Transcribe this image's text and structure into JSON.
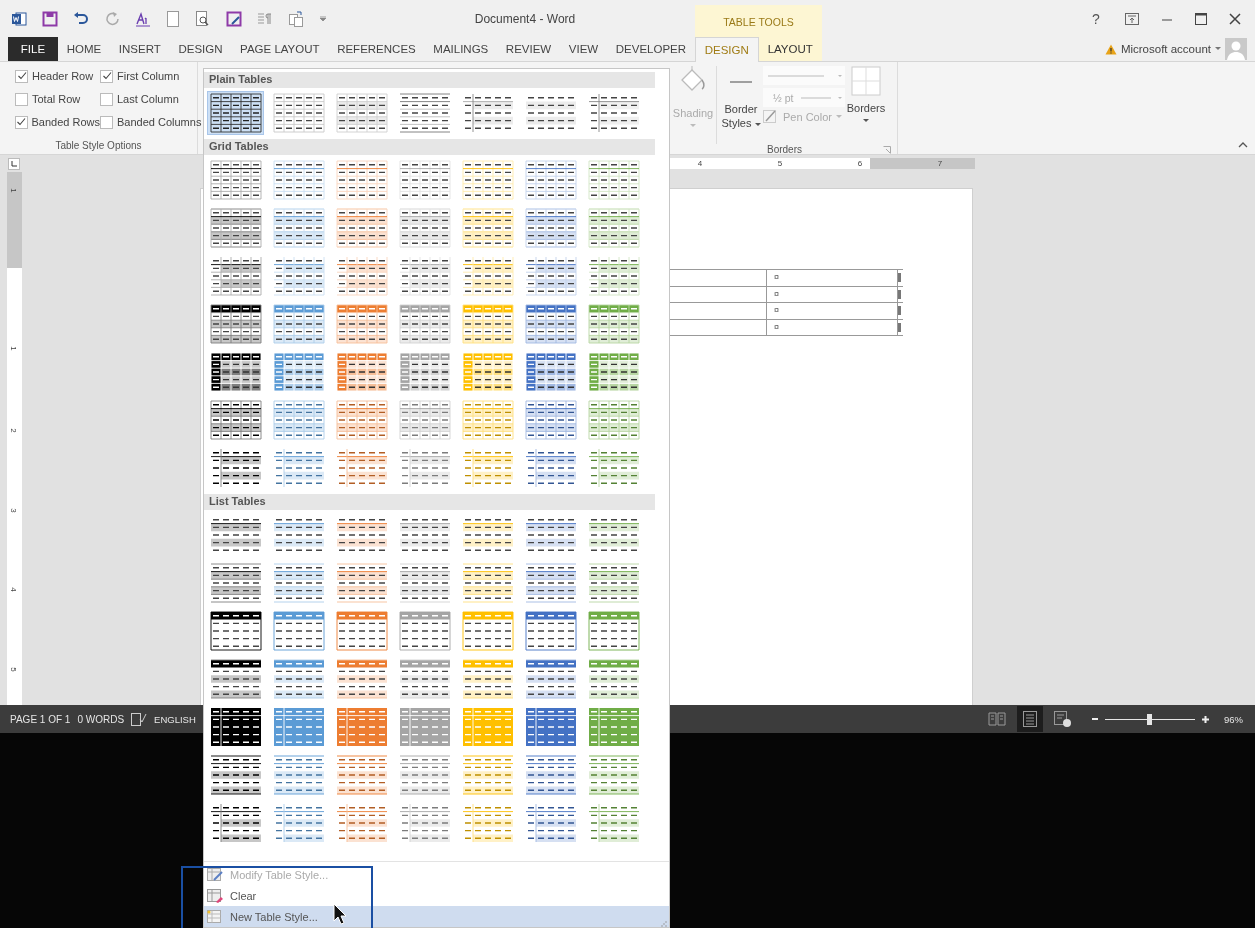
{
  "window": {
    "title": "Document4 - Word",
    "contextual_group": "TABLE TOOLS",
    "help_label": "?"
  },
  "ribbon_tabs": [
    {
      "label": "FILE",
      "kind": "file",
      "selected": false
    },
    {
      "label": "HOME",
      "kind": "normal",
      "selected": false
    },
    {
      "label": "INSERT",
      "kind": "normal",
      "selected": false
    },
    {
      "label": "DESIGN",
      "kind": "normal",
      "selected": false
    },
    {
      "label": "PAGE LAYOUT",
      "kind": "normal",
      "selected": false
    },
    {
      "label": "REFERENCES",
      "kind": "normal",
      "selected": false
    },
    {
      "label": "MAILINGS",
      "kind": "normal",
      "selected": false
    },
    {
      "label": "REVIEW",
      "kind": "normal",
      "selected": false
    },
    {
      "label": "VIEW",
      "kind": "normal",
      "selected": false
    },
    {
      "label": "DEVELOPER",
      "kind": "normal",
      "selected": false
    },
    {
      "label": "DESIGN",
      "kind": "contextual",
      "selected": true
    },
    {
      "label": "LAYOUT",
      "kind": "contextual",
      "selected": false
    }
  ],
  "account": {
    "label": "Microsoft account",
    "warning": true
  },
  "table_style_options": {
    "label": "Table Style Options",
    "options": [
      {
        "label": "Header Row",
        "checked": true
      },
      {
        "label": "First Column",
        "checked": true
      },
      {
        "label": "Total Row",
        "checked": false
      },
      {
        "label": "Last Column",
        "checked": false
      },
      {
        "label": "Banded Rows",
        "checked": true
      },
      {
        "label": "Banded Columns",
        "checked": false
      }
    ]
  },
  "borders_group": {
    "label": "Borders",
    "shading": {
      "label": "Shading",
      "disabled": true
    },
    "border_styles": {
      "label": "Border Styles"
    },
    "pen_weight": {
      "value": "½ pt"
    },
    "pen_color": {
      "label": "Pen Color",
      "disabled": true
    },
    "borders": {
      "label": "Borders"
    }
  },
  "ruler": {
    "horizontal_numbers": [
      "4",
      "5",
      "6",
      "7"
    ],
    "vertical_numbers": [
      "1",
      "1",
      "2",
      "3",
      "4",
      "5"
    ]
  },
  "document": {
    "table_rows": [
      {
        "column_2": "¤"
      },
      {
        "column_2": "¤"
      },
      {
        "column_2": "¤"
      },
      {
        "column_2": "¤"
      }
    ]
  },
  "status_bar": {
    "page": "PAGE 1 OF 1",
    "words": "0 WORDS",
    "language": "ENGLISH",
    "views": [
      {
        "kind": "read",
        "selected": false
      },
      {
        "kind": "print",
        "selected": true
      },
      {
        "kind": "web",
        "selected": false
      }
    ],
    "zoom": {
      "level": 0.5,
      "value": "96%"
    }
  },
  "gallery": {
    "sections": [
      {
        "title": "Plain Tables",
        "rows": [
          {
            "items": [
              {
                "kind": "table-grid",
                "selected": true
              },
              {
                "kind": "grid-table-light",
                "selected": false
              },
              {
                "kind": "plain-table-1",
                "selected": false
              },
              {
                "kind": "plain-table-2",
                "selected": false
              },
              {
                "kind": "plain-table-3",
                "selected": false
              },
              {
                "kind": "plain-table-4",
                "selected": false
              },
              {
                "kind": "plain-table-5",
                "selected": false
              }
            ]
          }
        ]
      },
      {
        "title": "Grid Tables",
        "rows": [
          {
            "kind": "grid-1",
            "items": [
              {
                "kind": "dark",
                "selected": false
              },
              {
                "kind": "accent-1",
                "selected": false
              },
              {
                "kind": "accent-2",
                "selected": false
              },
              {
                "kind": "accent-3",
                "selected": false
              },
              {
                "kind": "accent-4",
                "selected": false
              },
              {
                "kind": "accent-5",
                "selected": false
              },
              {
                "kind": "accent-6",
                "selected": false
              }
            ]
          },
          {
            "kind": "grid-2",
            "items": [
              {
                "kind": "dark",
                "selected": false
              },
              {
                "kind": "accent-1",
                "selected": false
              },
              {
                "kind": "accent-2",
                "selected": false
              },
              {
                "kind": "accent-3",
                "selected": false
              },
              {
                "kind": "accent-4",
                "selected": false
              },
              {
                "kind": "accent-5",
                "selected": false
              },
              {
                "kind": "accent-6",
                "selected": false
              }
            ]
          },
          {
            "kind": "grid-3",
            "items": [
              {
                "kind": "dark",
                "selected": false
              },
              {
                "kind": "accent-1",
                "selected": false
              },
              {
                "kind": "accent-2",
                "selected": false
              },
              {
                "kind": "accent-3",
                "selected": false
              },
              {
                "kind": "accent-4",
                "selected": false
              },
              {
                "kind": "accent-5",
                "selected": false
              },
              {
                "kind": "accent-6",
                "selected": false
              }
            ]
          },
          {
            "kind": "grid-4",
            "items": [
              {
                "kind": "dark",
                "selected": false
              },
              {
                "kind": "accent-1",
                "selected": false
              },
              {
                "kind": "accent-2",
                "selected": false
              },
              {
                "kind": "accent-3",
                "selected": false
              },
              {
                "kind": "accent-4",
                "selected": false
              },
              {
                "kind": "accent-5",
                "selected": false
              },
              {
                "kind": "accent-6",
                "selected": false
              }
            ]
          },
          {
            "kind": "grid-5",
            "items": [
              {
                "kind": "dark",
                "selected": false
              },
              {
                "kind": "accent-1",
                "selected": false
              },
              {
                "kind": "accent-2",
                "selected": false
              },
              {
                "kind": "accent-3",
                "selected": false
              },
              {
                "kind": "accent-4",
                "selected": false
              },
              {
                "kind": "accent-5",
                "selected": false
              },
              {
                "kind": "accent-6",
                "selected": false
              }
            ]
          },
          {
            "kind": "grid-6",
            "items": [
              {
                "kind": "dark",
                "selected": false
              },
              {
                "kind": "accent-1",
                "selected": false
              },
              {
                "kind": "accent-2",
                "selected": false
              },
              {
                "kind": "accent-3",
                "selected": false
              },
              {
                "kind": "accent-4",
                "selected": false
              },
              {
                "kind": "accent-5",
                "selected": false
              },
              {
                "kind": "accent-6",
                "selected": false
              }
            ]
          },
          {
            "kind": "grid-7",
            "items": [
              {
                "kind": "dark",
                "selected": false
              },
              {
                "kind": "accent-1",
                "selected": false
              },
              {
                "kind": "accent-2",
                "selected": false
              },
              {
                "kind": "accent-3",
                "selected": false
              },
              {
                "kind": "accent-4",
                "selected": false
              },
              {
                "kind": "accent-5",
                "selected": false
              },
              {
                "kind": "accent-6",
                "selected": false
              }
            ]
          }
        ]
      },
      {
        "title": "List Tables",
        "rows": [
          {
            "kind": "list-1",
            "items": [
              {
                "kind": "dark",
                "selected": false
              },
              {
                "kind": "accent-1",
                "selected": false
              },
              {
                "kind": "accent-2",
                "selected": false
              },
              {
                "kind": "accent-3",
                "selected": false
              },
              {
                "kind": "accent-4",
                "selected": false
              },
              {
                "kind": "accent-5",
                "selected": false
              },
              {
                "kind": "accent-6",
                "selected": false
              }
            ]
          },
          {
            "kind": "list-2",
            "items": [
              {
                "kind": "dark",
                "selected": false
              },
              {
                "kind": "accent-1",
                "selected": false
              },
              {
                "kind": "accent-2",
                "selected": false
              },
              {
                "kind": "accent-3",
                "selected": false
              },
              {
                "kind": "accent-4",
                "selected": false
              },
              {
                "kind": "accent-5",
                "selected": false
              },
              {
                "kind": "accent-6",
                "selected": false
              }
            ]
          },
          {
            "kind": "list-3",
            "items": [
              {
                "kind": "dark",
                "selected": false
              },
              {
                "kind": "accent-1",
                "selected": false
              },
              {
                "kind": "accent-2",
                "selected": false
              },
              {
                "kind": "accent-3",
                "selected": false
              },
              {
                "kind": "accent-4",
                "selected": false
              },
              {
                "kind": "accent-5",
                "selected": false
              },
              {
                "kind": "accent-6",
                "selected": false
              }
            ]
          },
          {
            "kind": "list-4",
            "items": [
              {
                "kind": "dark",
                "selected": false
              },
              {
                "kind": "accent-1",
                "selected": false
              },
              {
                "kind": "accent-2",
                "selected": false
              },
              {
                "kind": "accent-3",
                "selected": false
              },
              {
                "kind": "accent-4",
                "selected": false
              },
              {
                "kind": "accent-5",
                "selected": false
              },
              {
                "kind": "accent-6",
                "selected": false
              }
            ]
          },
          {
            "kind": "list-5",
            "items": [
              {
                "kind": "dark",
                "selected": false
              },
              {
                "kind": "accent-1",
                "selected": false
              },
              {
                "kind": "accent-2",
                "selected": false
              },
              {
                "kind": "accent-3",
                "selected": false
              },
              {
                "kind": "accent-4",
                "selected": false
              },
              {
                "kind": "accent-5",
                "selected": false
              },
              {
                "kind": "accent-6",
                "selected": false
              }
            ]
          },
          {
            "kind": "list-6",
            "items": [
              {
                "kind": "dark",
                "selected": false
              },
              {
                "kind": "accent-1",
                "selected": false
              },
              {
                "kind": "accent-2",
                "selected": false
              },
              {
                "kind": "accent-3",
                "selected": false
              },
              {
                "kind": "accent-4",
                "selected": false
              },
              {
                "kind": "accent-5",
                "selected": false
              },
              {
                "kind": "accent-6",
                "selected": false
              }
            ]
          },
          {
            "kind": "list-7",
            "items": [
              {
                "kind": "dark",
                "selected": false
              },
              {
                "kind": "accent-1",
                "selected": false
              },
              {
                "kind": "accent-2",
                "selected": false
              },
              {
                "kind": "accent-3",
                "selected": false
              },
              {
                "kind": "accent-4",
                "selected": false
              },
              {
                "kind": "accent-5",
                "selected": false
              },
              {
                "kind": "accent-6",
                "selected": false
              }
            ]
          }
        ]
      }
    ],
    "menu": [
      {
        "label": "Modify Table Style...",
        "kind": "modify",
        "disabled": true,
        "selected": false
      },
      {
        "label": "Clear",
        "kind": "clear",
        "disabled": false,
        "selected": false
      },
      {
        "label": "New Table Style...",
        "kind": "new",
        "disabled": false,
        "selected": true
      }
    ]
  }
}
